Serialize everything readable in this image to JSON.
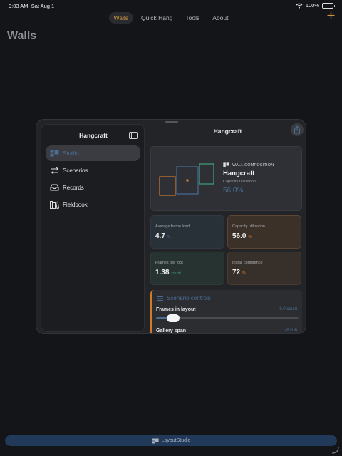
{
  "status_bar": {
    "time": "9:03 AM",
    "date": "Sat Aug 1",
    "battery": "100%"
  },
  "top_tabs": [
    {
      "label": "Walls",
      "active": true
    },
    {
      "label": "Quick Hang",
      "active": false
    },
    {
      "label": "Tools",
      "active": false
    },
    {
      "label": "About",
      "active": false
    }
  ],
  "page_title": "Walls",
  "sidebar": {
    "title": "Hangcraft",
    "items": [
      {
        "label": "Studio",
        "icon": "wall-layout-icon",
        "active": true
      },
      {
        "label": "Scenarios",
        "icon": "arrows-swap-icon",
        "active": false
      },
      {
        "label": "Records",
        "icon": "tray-icon",
        "active": false
      },
      {
        "label": "Fieldbook",
        "icon": "books-icon",
        "active": false
      }
    ]
  },
  "detail": {
    "title": "Hangcraft",
    "composition": {
      "label": "WALL COMPOSITION",
      "name": "Hangcraft",
      "sub": "Capacity utilization",
      "value": "56.0%"
    },
    "metrics": [
      {
        "label": "Average frame load",
        "value": "4.7",
        "unit": "%",
        "unit_color": "#4a6d94"
      },
      {
        "label": "Capacity utilization",
        "value": "56.0",
        "unit": "%",
        "unit_color": "#d07a2e"
      },
      {
        "label": "Frames per foot",
        "value": "1.38",
        "unit": "count",
        "unit_color": "#3fa37a"
      },
      {
        "label": "Install confidence",
        "value": "72",
        "unit": "%",
        "unit_color": "#d07a2e"
      }
    ],
    "controls": {
      "title": "Scenario controls",
      "frames_label": "Frames in layout",
      "frames_value": "9.0 count",
      "frames_fraction": 0.12,
      "span_label": "Gallery span",
      "span_value": "78.0 in"
    }
  },
  "bottom_bar": {
    "label": "LayoutStudio"
  },
  "colors": {
    "accent": "#c7923f",
    "blue": "#4a6d94",
    "orange": "#d07a2e",
    "green": "#3fa37a"
  }
}
